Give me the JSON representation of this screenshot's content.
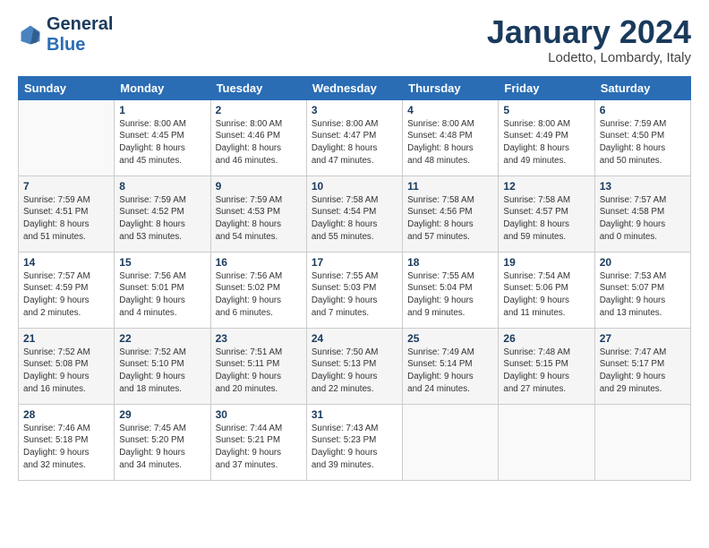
{
  "header": {
    "logo_line1": "General",
    "logo_line2": "Blue",
    "month_title": "January 2024",
    "subtitle": "Lodetto, Lombardy, Italy"
  },
  "weekdays": [
    "Sunday",
    "Monday",
    "Tuesday",
    "Wednesday",
    "Thursday",
    "Friday",
    "Saturday"
  ],
  "weeks": [
    [
      {
        "day": "",
        "info": ""
      },
      {
        "day": "1",
        "info": "Sunrise: 8:00 AM\nSunset: 4:45 PM\nDaylight: 8 hours\nand 45 minutes."
      },
      {
        "day": "2",
        "info": "Sunrise: 8:00 AM\nSunset: 4:46 PM\nDaylight: 8 hours\nand 46 minutes."
      },
      {
        "day": "3",
        "info": "Sunrise: 8:00 AM\nSunset: 4:47 PM\nDaylight: 8 hours\nand 47 minutes."
      },
      {
        "day": "4",
        "info": "Sunrise: 8:00 AM\nSunset: 4:48 PM\nDaylight: 8 hours\nand 48 minutes."
      },
      {
        "day": "5",
        "info": "Sunrise: 8:00 AM\nSunset: 4:49 PM\nDaylight: 8 hours\nand 49 minutes."
      },
      {
        "day": "6",
        "info": "Sunrise: 7:59 AM\nSunset: 4:50 PM\nDaylight: 8 hours\nand 50 minutes."
      }
    ],
    [
      {
        "day": "7",
        "info": "Sunrise: 7:59 AM\nSunset: 4:51 PM\nDaylight: 8 hours\nand 51 minutes."
      },
      {
        "day": "8",
        "info": "Sunrise: 7:59 AM\nSunset: 4:52 PM\nDaylight: 8 hours\nand 53 minutes."
      },
      {
        "day": "9",
        "info": "Sunrise: 7:59 AM\nSunset: 4:53 PM\nDaylight: 8 hours\nand 54 minutes."
      },
      {
        "day": "10",
        "info": "Sunrise: 7:58 AM\nSunset: 4:54 PM\nDaylight: 8 hours\nand 55 minutes."
      },
      {
        "day": "11",
        "info": "Sunrise: 7:58 AM\nSunset: 4:56 PM\nDaylight: 8 hours\nand 57 minutes."
      },
      {
        "day": "12",
        "info": "Sunrise: 7:58 AM\nSunset: 4:57 PM\nDaylight: 8 hours\nand 59 minutes."
      },
      {
        "day": "13",
        "info": "Sunrise: 7:57 AM\nSunset: 4:58 PM\nDaylight: 9 hours\nand 0 minutes."
      }
    ],
    [
      {
        "day": "14",
        "info": "Sunrise: 7:57 AM\nSunset: 4:59 PM\nDaylight: 9 hours\nand 2 minutes."
      },
      {
        "day": "15",
        "info": "Sunrise: 7:56 AM\nSunset: 5:01 PM\nDaylight: 9 hours\nand 4 minutes."
      },
      {
        "day": "16",
        "info": "Sunrise: 7:56 AM\nSunset: 5:02 PM\nDaylight: 9 hours\nand 6 minutes."
      },
      {
        "day": "17",
        "info": "Sunrise: 7:55 AM\nSunset: 5:03 PM\nDaylight: 9 hours\nand 7 minutes."
      },
      {
        "day": "18",
        "info": "Sunrise: 7:55 AM\nSunset: 5:04 PM\nDaylight: 9 hours\nand 9 minutes."
      },
      {
        "day": "19",
        "info": "Sunrise: 7:54 AM\nSunset: 5:06 PM\nDaylight: 9 hours\nand 11 minutes."
      },
      {
        "day": "20",
        "info": "Sunrise: 7:53 AM\nSunset: 5:07 PM\nDaylight: 9 hours\nand 13 minutes."
      }
    ],
    [
      {
        "day": "21",
        "info": "Sunrise: 7:52 AM\nSunset: 5:08 PM\nDaylight: 9 hours\nand 16 minutes."
      },
      {
        "day": "22",
        "info": "Sunrise: 7:52 AM\nSunset: 5:10 PM\nDaylight: 9 hours\nand 18 minutes."
      },
      {
        "day": "23",
        "info": "Sunrise: 7:51 AM\nSunset: 5:11 PM\nDaylight: 9 hours\nand 20 minutes."
      },
      {
        "day": "24",
        "info": "Sunrise: 7:50 AM\nSunset: 5:13 PM\nDaylight: 9 hours\nand 22 minutes."
      },
      {
        "day": "25",
        "info": "Sunrise: 7:49 AM\nSunset: 5:14 PM\nDaylight: 9 hours\nand 24 minutes."
      },
      {
        "day": "26",
        "info": "Sunrise: 7:48 AM\nSunset: 5:15 PM\nDaylight: 9 hours\nand 27 minutes."
      },
      {
        "day": "27",
        "info": "Sunrise: 7:47 AM\nSunset: 5:17 PM\nDaylight: 9 hours\nand 29 minutes."
      }
    ],
    [
      {
        "day": "28",
        "info": "Sunrise: 7:46 AM\nSunset: 5:18 PM\nDaylight: 9 hours\nand 32 minutes."
      },
      {
        "day": "29",
        "info": "Sunrise: 7:45 AM\nSunset: 5:20 PM\nDaylight: 9 hours\nand 34 minutes."
      },
      {
        "day": "30",
        "info": "Sunrise: 7:44 AM\nSunset: 5:21 PM\nDaylight: 9 hours\nand 37 minutes."
      },
      {
        "day": "31",
        "info": "Sunrise: 7:43 AM\nSunset: 5:23 PM\nDaylight: 9 hours\nand 39 minutes."
      },
      {
        "day": "",
        "info": ""
      },
      {
        "day": "",
        "info": ""
      },
      {
        "day": "",
        "info": ""
      }
    ]
  ]
}
